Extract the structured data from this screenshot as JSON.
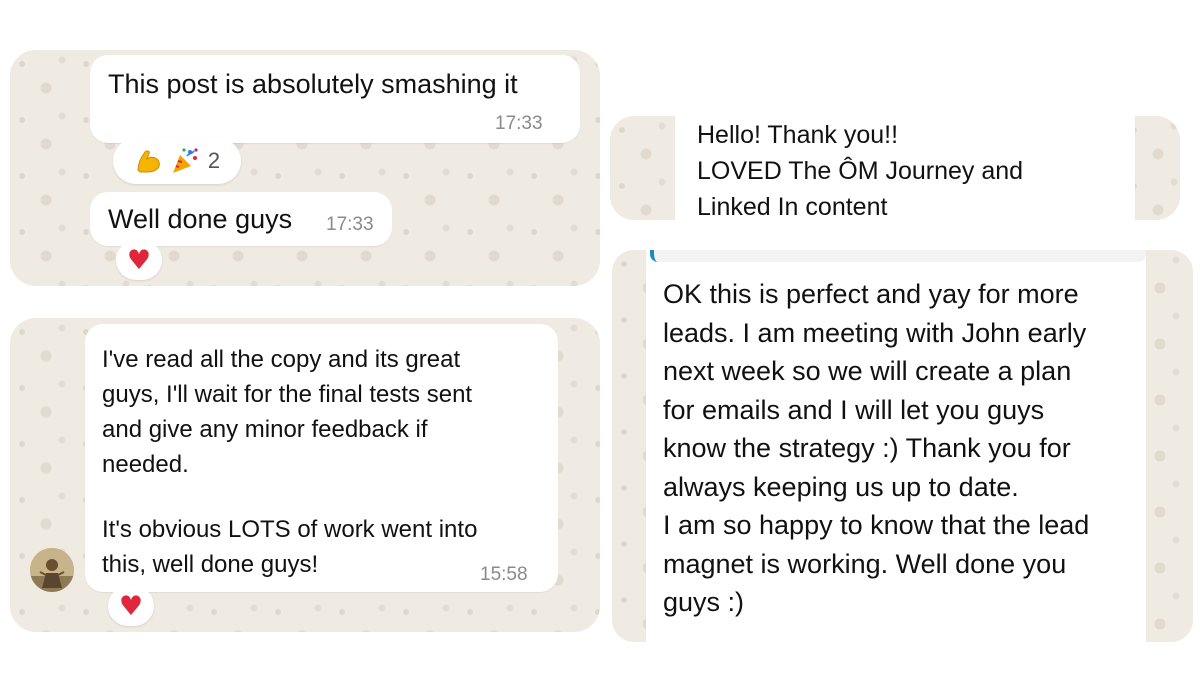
{
  "top_left_chat": {
    "message_1": {
      "text": "This post is absolutely smashing it",
      "time": "17:33",
      "reactions": {
        "icons": [
          "flexed-biceps-icon",
          "party-popper-icon"
        ],
        "count": "2"
      }
    },
    "message_2": {
      "text": "Well done guys",
      "time": "17:33",
      "reactions": {
        "icons": [
          "red-heart-icon"
        ]
      }
    }
  },
  "bottom_left_chat": {
    "message": {
      "paragraph_1": "I've read all the copy and its great\nguys, I'll wait for the final tests sent\nand give any minor feedback if\nneeded.",
      "paragraph_2": "It's obvious LOTS of work went into\nthis, well done guys!",
      "time": "15:58",
      "reactions": {
        "icons": [
          "red-heart-icon"
        ]
      }
    },
    "sender_avatar_icon": "profile-photo"
  },
  "top_right_chat": {
    "message": {
      "text": "Hello! Thank you!!\nLOVED The ÔM Journey and\nLinked In content"
    }
  },
  "bottom_right_chat": {
    "message": {
      "text": "OK this is perfect and yay for more\nleads. I am meeting with John early\nnext week so we will create a plan\nfor emails and I will let you guys\nknow the strategy :) Thank you for\nalways keeping us up to date.\nI am so happy to know that the lead\nmagnet is working. Well done you\nguys :)"
    }
  },
  "colors": {
    "wallpaper": "#efeae2",
    "bubble": "#ffffff",
    "timestamp": "#8a8a8a",
    "heart": "#e0263a",
    "quote_accent": "#1e88c7"
  }
}
